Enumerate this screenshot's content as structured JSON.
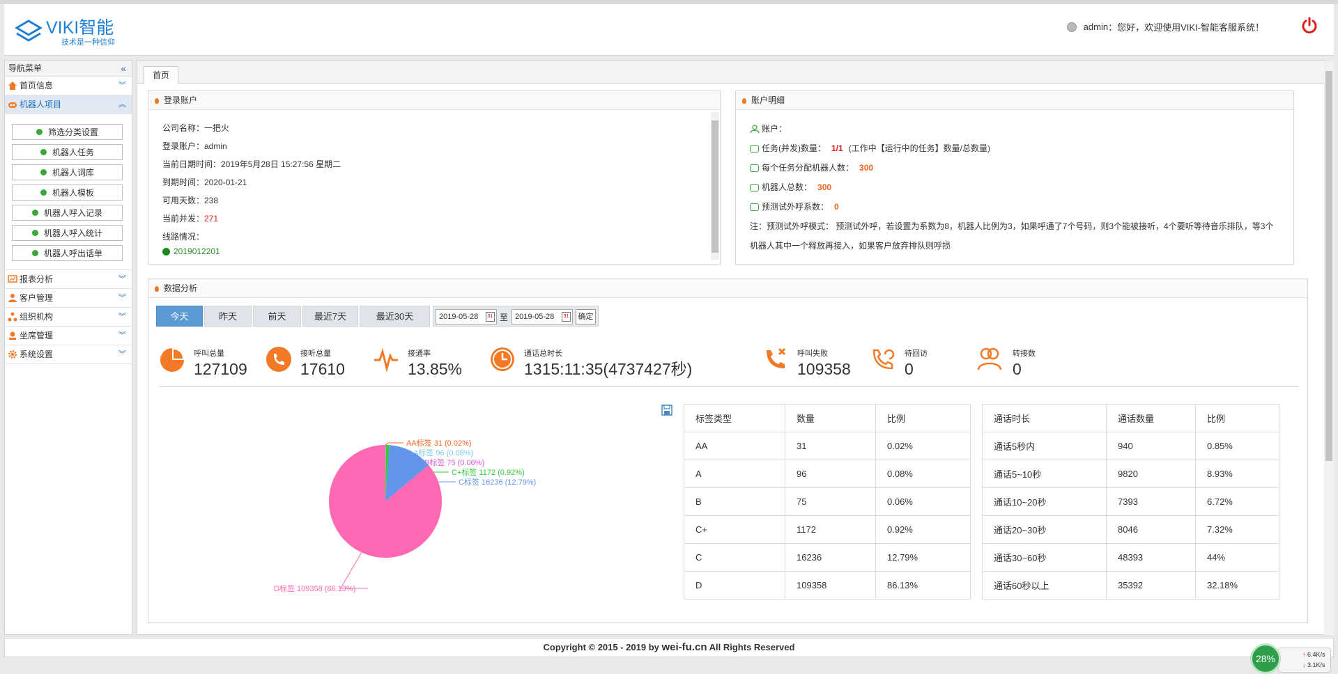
{
  "header": {
    "logo_title": "VIKI智能",
    "logo_sub": "技术是一种信仰",
    "user": "admin",
    "welcome": "：您好，欢迎使用VIKI-智能客服系统！"
  },
  "sidebar": {
    "title": "导航菜单",
    "menus": [
      {
        "label": "首页信息"
      },
      {
        "label": "机器人项目"
      },
      {
        "label": "报表分析"
      },
      {
        "label": "客户管理"
      },
      {
        "label": "组织机构"
      },
      {
        "label": "坐席管理"
      },
      {
        "label": "系统设置"
      }
    ],
    "subitems": [
      "筛选分类设置",
      "机器人任务",
      "机器人词库",
      "机器人模板",
      "机器人呼入记录",
      "机器人呼入统计",
      "机器人呼出话单"
    ]
  },
  "tabs": {
    "home": "首页"
  },
  "login_panel": {
    "title": "登录账户",
    "company": "公司名称：一把火",
    "account": "登录账户：admin",
    "datetime": "当前日期时间：2019年5月28日 15:27:56 星期二",
    "expire": "到期时间：2020-01-21",
    "days": "可用天数：238",
    "concurrent_label": "当前并发：",
    "concurrent_value": "271",
    "line_label": "线路情况：",
    "line_value": "2019012201"
  },
  "detail_panel": {
    "title": "账户明细",
    "account": "账户：",
    "tasks_label": "任务(并发)数量：",
    "tasks_value": "1/1",
    "tasks_note": "(工作中【运行中的任务】数量/总数量)",
    "per_task_label": "每个任务分配机器人数：",
    "per_task_value": "300",
    "robot_total_label": "机器人总数：",
    "robot_total_value": "300",
    "predict_label": "预测试外呼系数：",
    "predict_value": "0",
    "note": "注：预测试外呼模式：   预测试外呼，若设置为系数为8，机器人比例为3，如果呼通了7个号码，则3个能被接听，4个要听等待音乐排队，等3个机器人其中一个释放再接入，如果客户放弃排队则呼损"
  },
  "analysis": {
    "title": "数据分析",
    "filters": [
      "今天",
      "昨天",
      "前天",
      "最近7天",
      "最近30天"
    ],
    "date_from": "2019-05-28",
    "date_to": "2019-05-28",
    "to_label": "至",
    "confirm": "确定",
    "stats": [
      {
        "label": "呼叫总量",
        "value": "127109"
      },
      {
        "label": "接听总量",
        "value": "17610"
      },
      {
        "label": "接通率",
        "value": "13.85%"
      },
      {
        "label": "通话总时长",
        "value": "1315:11:35(4737427秒)"
      },
      {
        "label": "呼叫失败",
        "value": "109358"
      },
      {
        "label": "待回访",
        "value": "0"
      },
      {
        "label": "转接数",
        "value": "0"
      }
    ]
  },
  "chart_data": {
    "type": "pie",
    "series": [
      {
        "label": "AA标签 31 (0.02%)",
        "value": 31,
        "color": "#f0651f"
      },
      {
        "label": "A标签 96 (0.08%)",
        "value": 96,
        "color": "#7ec8e3"
      },
      {
        "label": "B标签 75 (0.06%)",
        "value": 75,
        "color": "#da5bd6"
      },
      {
        "label": "C+标签 1172 (0.92%)",
        "value": 1172,
        "color": "#32cd32"
      },
      {
        "label": "C标签 16236 (12.79%)",
        "value": 16236,
        "color": "#6495ed"
      },
      {
        "label": "D标签 109358 (86.13%)",
        "value": 109358,
        "color": "#ff69b4"
      }
    ]
  },
  "tag_table": {
    "headers": [
      "标签类型",
      "数量",
      "比例"
    ],
    "rows": [
      [
        "AA",
        "31",
        "0.02%"
      ],
      [
        "A",
        "96",
        "0.08%"
      ],
      [
        "B",
        "75",
        "0.06%"
      ],
      [
        "C+",
        "1172",
        "0.92%"
      ],
      [
        "C",
        "16236",
        "12.79%"
      ],
      [
        "D",
        "109358",
        "86.13%"
      ]
    ]
  },
  "duration_table": {
    "headers": [
      "通话时长",
      "通话数量",
      "比例"
    ],
    "rows": [
      [
        "通话5秒内",
        "940",
        "0.85%"
      ],
      [
        "通话5~10秒",
        "9820",
        "8.93%"
      ],
      [
        "通话10~20秒",
        "7393",
        "6.72%"
      ],
      [
        "通话20~30秒",
        "8046",
        "7.32%"
      ],
      [
        "通话30~60秒",
        "48393",
        "44%"
      ],
      [
        "通话60秒以上",
        "35392",
        "32.18%"
      ]
    ]
  },
  "footer": {
    "prefix": "Copyright © 2015 - 2019 by ",
    "site": "wei-fu.cn",
    "suffix": " All Rights Reserved"
  },
  "net_widget": {
    "percent": "28%",
    "up": "6.4K/s",
    "down": "3.1K/s"
  }
}
